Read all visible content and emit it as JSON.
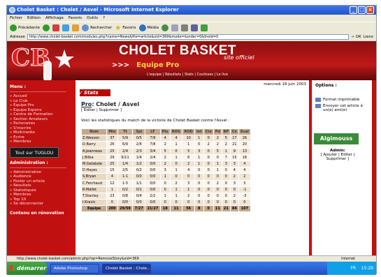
{
  "window": {
    "title": "Cholet Basket : Cholet / Asvel - Microsoft Internet Explorer"
  },
  "menu": [
    "Fichier",
    "Edition",
    "Affichage",
    "Favoris",
    "Outils",
    "?"
  ],
  "toolbar": {
    "back": "Précédente",
    "search": "Rechercher",
    "favorites": "Favoris",
    "media": "Média"
  },
  "address": {
    "label": "Adresse",
    "url": "http://www.cholet-basket.com/modules.php?name=News&file=article&sid=369&mode=&order=0&thold=0",
    "go": "OK",
    "links": "Liens"
  },
  "banner": {
    "logo": "CB",
    "title": "CHOLET BASKET",
    "subtitle": "site officiel",
    "section_arrows": ">>>",
    "section": "Equipe Pro",
    "nav": "L'equipe | Résultats | Stats | Coulisses | Le live"
  },
  "sidebar": {
    "menu_title": "Menu :",
    "menu": [
      "Accueil",
      "Le Club",
      "Equipe Pro",
      "Equipe Espoirs",
      "Centre de Formation",
      "Section Amateurs",
      "Partenaires",
      "S'inscrire",
      "Multimedia",
      "Ecrire",
      "Membres"
    ],
    "banner": "Tout sur TUGLOU",
    "admin_title": "Administration :",
    "admin": [
      "Administration",
      "Audience",
      "Poster un article",
      "Résultats",
      "Statistiques",
      "Membres",
      "Top 10",
      "Se déconnecter"
    ],
    "footer": "Contenu en rénovation"
  },
  "main": {
    "date": "mercredi 18 juin 2003",
    "section": "Stats",
    "pro_prefix": "Pro",
    "title": ": Cholet / Asvel",
    "edit": "[ Editer | Supprimer ]",
    "intro": "Voici les statistiques du match de la victoire de Cholet Basket contre l'Asvel :",
    "table": {
      "headers": [
        "Nom",
        "Min",
        "Tt",
        "3pt",
        "LF",
        "Pts",
        "ROG",
        "ROD",
        "Int",
        "Cte",
        "Pd",
        "BP",
        "Cn",
        "Eval"
      ],
      "rows": [
        [
          "Z.Wesson",
          "37",
          "5/9",
          "0/5",
          "7/9",
          "4",
          "4",
          "10",
          "1",
          "0",
          "2",
          "5",
          "17",
          "26"
        ],
        [
          "D.Barry",
          "26",
          "6/9",
          "2/4",
          "7/8",
          "2",
          "1",
          "1",
          "0",
          "2",
          "2",
          "2",
          "21",
          "20"
        ],
        [
          "A.Jeanneau",
          "25",
          "2/4",
          "2/3",
          "3/4",
          "5",
          "0",
          "5",
          "3",
          "0",
          "5",
          "1",
          "9",
          "13"
        ],
        [
          "J.Bilba",
          "29",
          "6/11",
          "1/4",
          "2/4",
          "2",
          "1",
          "6",
          "1",
          "0",
          "0",
          "7",
          "15",
          "18"
        ],
        [
          "M.Gelabale",
          "25",
          "1/4",
          "1/2",
          "0/0",
          "2",
          "0",
          "2",
          "1",
          "0",
          "1",
          "3",
          "3",
          "4"
        ],
        [
          "D.Hayes",
          "15",
          "2/5",
          "0/2",
          "0/0",
          "3",
          "1",
          "4",
          "0",
          "0",
          "1",
          "0",
          "4",
          "4"
        ],
        [
          "S.Bryan",
          "4",
          "1-1",
          "0/0",
          "0/0",
          "1",
          "0",
          "0",
          "0",
          "0",
          "0",
          "0",
          "2",
          "2"
        ],
        [
          "C.Ferchaud",
          "12",
          "1-5",
          "1/1",
          "0/0",
          "0",
          "2",
          "3",
          "0",
          "0",
          "2",
          "0",
          "3",
          "3"
        ],
        [
          "R.Mallet",
          "1",
          "0/2",
          "0/1",
          "0/0",
          "0",
          "1",
          "1",
          "0",
          "0",
          "0",
          "0",
          "0",
          "-1"
        ],
        [
          "T.Stanley",
          "23",
          "0/8",
          "0/4",
          "2/2",
          "1",
          "1",
          "2",
          "0",
          "0",
          "0",
          "0",
          "2",
          "-3"
        ],
        [
          "I.Kravic",
          "0",
          "0/0",
          "0/0",
          "0/0",
          "0",
          "0",
          "0",
          "0",
          "0",
          "0",
          "0",
          "0",
          "0"
        ]
      ],
      "total": [
        "Equipe",
        "200",
        "29/59",
        "7/27",
        "21/27",
        "18",
        "11",
        "56",
        "8",
        "0",
        "11",
        "21",
        "84",
        "107"
      ]
    }
  },
  "right": {
    "options_title": "Options :",
    "options": [
      "Format imprimable",
      "Envoyer cet article à un(e) ami(e)"
    ],
    "sponsor": "Algimouss",
    "admin_title": "Admin:",
    "admin_links": "[ Ajouter | Editer | Supprimer ]"
  },
  "status": {
    "url": "http://www.cholet-basket.com/admin.php?op=RemoveStory&sid=369",
    "zone": "Internet"
  },
  "taskbar": {
    "start": "démarrer",
    "tasks": [
      "Adobe Photoshop",
      "Cholet Basket : Chole..."
    ],
    "lang": "FR",
    "clock": "15:29"
  }
}
